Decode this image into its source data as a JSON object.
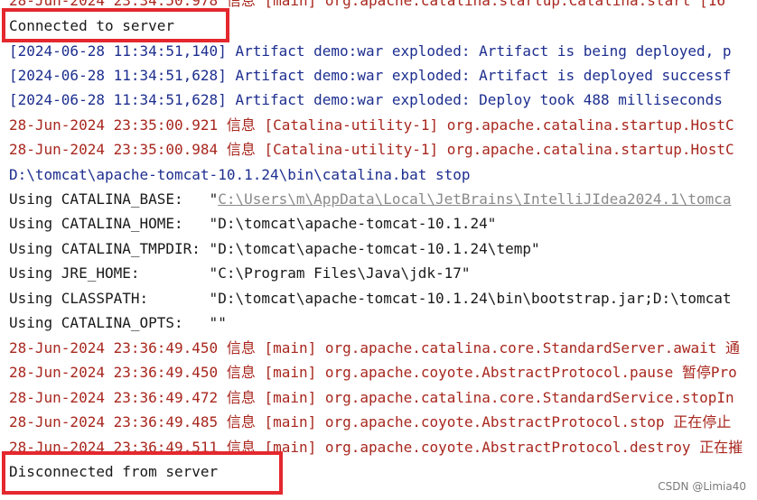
{
  "console": {
    "lines": [
      {
        "text": "28-Jun-2024 23:34:50.978 信息 [main] org.apache.catalina.startup.Catalina.start [16",
        "color": "#a8271e"
      },
      {
        "text": "Connected to server",
        "color": "#1a1a1a"
      },
      {
        "text": "[2024-06-28 11:34:51,140] Artifact demo:war exploded: Artifact is being deployed, p",
        "color": "#1d2e8f"
      },
      {
        "text": "[2024-06-28 11:34:51,628] Artifact demo:war exploded: Artifact is deployed successf",
        "color": "#1d2e8f"
      },
      {
        "text": "[2024-06-28 11:34:51,628] Artifact demo:war exploded: Deploy took 488 milliseconds",
        "color": "#1d2e8f"
      },
      {
        "text": "28-Jun-2024 23:35:00.921 信息 [Catalina-utility-1] org.apache.catalina.startup.HostC",
        "color": "#a8271e"
      },
      {
        "text": "28-Jun-2024 23:35:00.984 信息 [Catalina-utility-1] org.apache.catalina.startup.HostC",
        "color": "#a8271e"
      },
      {
        "text": "D:\\tomcat\\apache-tomcat-10.1.24\\bin\\catalina.bat stop",
        "color": "#1d2e8f"
      },
      {
        "label": "Using CATALINA_BASE:   ",
        "q1": "\"",
        "link": "C:\\Users\\m\\AppData\\Local\\JetBrains\\IntelliJIdea2024.1\\tomca",
        "color": "#1a1a1a"
      },
      {
        "text": "Using CATALINA_HOME:   \"D:\\tomcat\\apache-tomcat-10.1.24\"",
        "color": "#1a1a1a"
      },
      {
        "text": "Using CATALINA_TMPDIR: \"D:\\tomcat\\apache-tomcat-10.1.24\\temp\"",
        "color": "#1a1a1a"
      },
      {
        "text": "Using JRE_HOME:        \"C:\\Program Files\\Java\\jdk-17\"",
        "color": "#1a1a1a"
      },
      {
        "text": "Using CLASSPATH:       \"D:\\tomcat\\apache-tomcat-10.1.24\\bin\\bootstrap.jar;D:\\tomcat",
        "color": "#1a1a1a"
      },
      {
        "text": "Using CATALINA_OPTS:   \"\"",
        "color": "#1a1a1a"
      },
      {
        "text": "28-Jun-2024 23:36:49.450 信息 [main] org.apache.catalina.core.StandardServer.await 通",
        "color": "#a8271e"
      },
      {
        "text": "28-Jun-2024 23:36:49.450 信息 [main] org.apache.coyote.AbstractProtocol.pause 暂停Pro",
        "color": "#a8271e"
      },
      {
        "text": "28-Jun-2024 23:36:49.472 信息 [main] org.apache.catalina.core.StandardService.stopIn",
        "color": "#a8271e"
      },
      {
        "text": "28-Jun-2024 23:36:49.485 信息 [main] org.apache.coyote.AbstractProtocol.stop 正在停止",
        "color": "#a8271e"
      },
      {
        "text": "28-Jun-2024 23:36:49.511 信息 [main] org.apache.coyote.AbstractProtocol.destroy 正在摧",
        "color": "#a8271e"
      },
      {
        "text": "Disconnected from server",
        "color": "#1a1a1a"
      }
    ]
  },
  "watermark": "CSDN @Limia40"
}
